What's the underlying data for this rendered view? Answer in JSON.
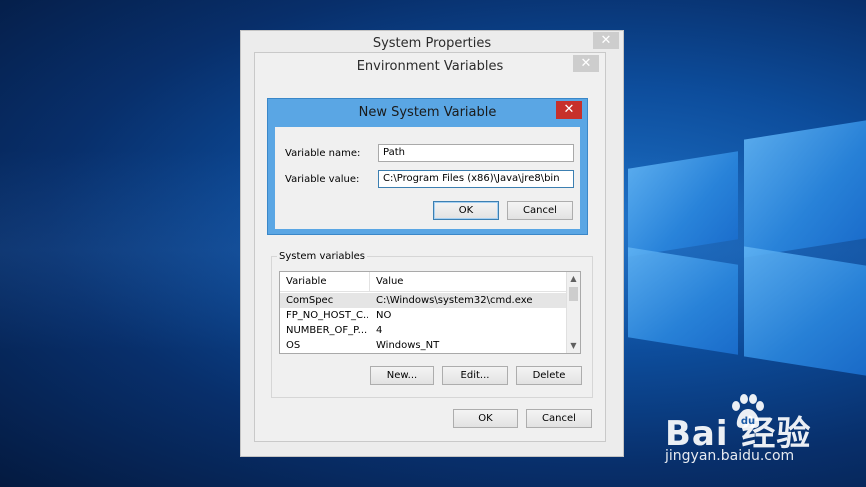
{
  "system_properties": {
    "title": "System Properties",
    "close": "✕"
  },
  "environment_variables": {
    "title": "Environment Variables",
    "close": "✕",
    "system_variables": {
      "label": "System variables",
      "columns": [
        "Variable",
        "Value"
      ],
      "rows": [
        {
          "variable": "ComSpec",
          "value": "C:\\Windows\\system32\\cmd.exe"
        },
        {
          "variable": "FP_NO_HOST_C...",
          "value": "NO"
        },
        {
          "variable": "NUMBER_OF_P...",
          "value": "4"
        },
        {
          "variable": "OS",
          "value": "Windows_NT"
        }
      ],
      "buttons": {
        "new": "New...",
        "edit": "Edit...",
        "delete": "Delete"
      }
    },
    "buttons": {
      "ok": "OK",
      "cancel": "Cancel"
    }
  },
  "new_system_variable": {
    "title": "New System Variable",
    "close": "✕",
    "name_label": "Variable name:",
    "name_value": "Path",
    "value_label": "Variable value:",
    "value_value": "C:\\Program Files (x86)\\Java\\jre8\\bin",
    "buttons": {
      "ok": "OK",
      "cancel": "Cancel"
    }
  },
  "watermark": {
    "logo": "Bai  经验",
    "url": "jingyan.baidu.com"
  },
  "colors": {
    "accent": "#5aa6e4",
    "close_red": "#c7302b",
    "desktop": "#0d4d9c"
  },
  "icons": {
    "close": "close-icon",
    "scroll_up": "chevron-up-icon",
    "scroll_down": "chevron-down-icon",
    "paw": "baidu-paw-icon"
  }
}
